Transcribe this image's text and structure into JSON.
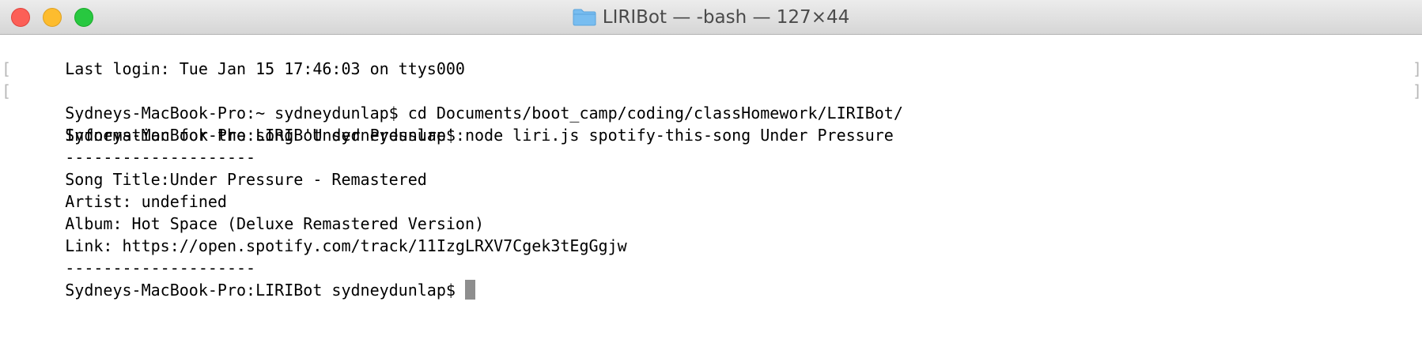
{
  "window": {
    "title": "LIRIBot — -bash — 127×44",
    "folder_icon": "folder-icon"
  },
  "terminal": {
    "lines": [
      {
        "text": "Last login: Tue Jan 15 17:46:03 on ttys000"
      },
      {
        "text": "Sydneys-MacBook-Pro:~ sydneydunlap$ cd Documents/boot_camp/coding/classHomework/LIRIBot/"
      },
      {
        "text": "Sydneys-MacBook-Pro:LIRIBot sydneydunlap$ node liri.js spotify-this-song Under Pressure"
      },
      {
        "text": "Information for the song 'Under Pressure':"
      },
      {
        "text": "--------------------"
      },
      {
        "text": "Song Title:Under Pressure - Remastered"
      },
      {
        "text": "Artist: undefined"
      },
      {
        "text": "Album: Hot Space (Deluxe Remastered Version)"
      },
      {
        "text": "Link: https://open.spotify.com/track/11IzgLRXV7Cgek3tEgGgjw"
      },
      {
        "text": "--------------------"
      }
    ],
    "prompt": "Sydneys-MacBook-Pro:LIRIBot sydneydunlap$ ",
    "mark_left": "[",
    "mark_right": "]"
  },
  "colors": {
    "close": "#fc5f57",
    "minimize": "#fdbc2e",
    "zoom": "#28c840",
    "folder": "#78bdf0"
  }
}
